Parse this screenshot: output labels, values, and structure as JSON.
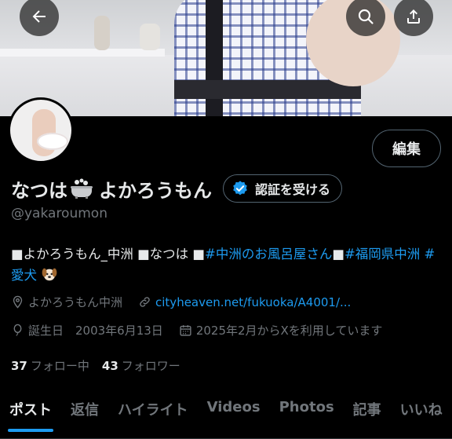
{
  "header": {
    "back_icon": "back-arrow-icon",
    "search_icon": "search-icon",
    "share_icon": "share-icon"
  },
  "profile": {
    "name_part1": "なつは",
    "name_emoji": "bathtub-icon",
    "name_part2": "よかろうもん",
    "handle": "@yakaroumon",
    "edit_label": "編集",
    "verify_label": "認証を受ける",
    "bio": {
      "text1": "■よかろうもん_中洲 ■なつは ■",
      "tag1": "#中洲のお風呂屋さん",
      "text2": "■",
      "tag2": "#福岡県中洲",
      "text3": " ",
      "tag3": "#",
      "line2_tag": "愛犬",
      "emoji": "dog-face-icon"
    },
    "location": "よかろうもん中洲",
    "website": "cityheaven.net/fukuoka/A4001/...",
    "birthday": "誕生日　2003年6月13日",
    "joined": "2025年2月からXを利用しています",
    "following_count": "37",
    "following_label": "フォロー中",
    "followers_count": "43",
    "followers_label": "フォロワー"
  },
  "tabs": [
    {
      "label": "ポスト",
      "active": true
    },
    {
      "label": "返信",
      "active": false
    },
    {
      "label": "ハイライト",
      "active": false
    },
    {
      "label": "Videos",
      "active": false
    },
    {
      "label": "Photos",
      "active": false
    },
    {
      "label": "記事",
      "active": false
    },
    {
      "label": "いいね",
      "active": false
    }
  ],
  "colors": {
    "background": "#000000",
    "text": "#e7e9ea",
    "secondary": "#71767b",
    "accent": "#1d9bf0"
  }
}
